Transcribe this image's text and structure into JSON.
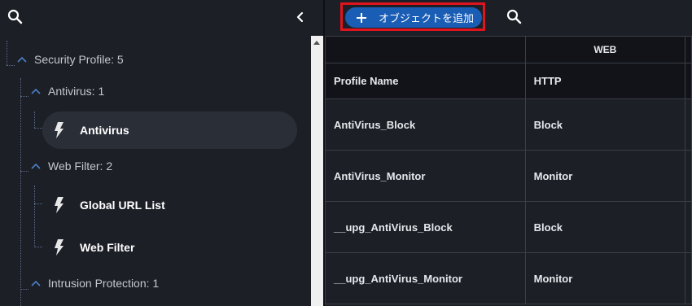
{
  "toolbar": {
    "add_object_label": "オブジェクトを追加"
  },
  "tree": {
    "root": {
      "label": "Security Profile: 5"
    },
    "groups": [
      {
        "label": "Antivirus: 1",
        "items": [
          {
            "label": "Antivirus",
            "selected": true
          }
        ]
      },
      {
        "label": "Web Filter: 2",
        "items": [
          {
            "label": "Global URL List"
          },
          {
            "label": "Web Filter"
          }
        ]
      },
      {
        "label": "Intrusion Protection: 1"
      }
    ]
  },
  "table": {
    "group_header": "WEB",
    "columns": [
      "Profile Name",
      "HTTP"
    ],
    "rows": [
      [
        "AntiVirus_Block",
        "Block"
      ],
      [
        "AntiVirus_Monitor",
        "Monitor"
      ],
      [
        "__upg_AntiVirus_Block",
        "Block"
      ],
      [
        "__upg_AntiVirus_Monitor",
        "Monitor"
      ]
    ]
  },
  "colors": {
    "background": "#1c1f26",
    "accent_button": "#1a5db5",
    "highlight_box": "#e0141e",
    "header_background": "#111318"
  },
  "icons": [
    "search-icon",
    "collapse-panel-icon",
    "chevron-up-icon",
    "bolt-icon",
    "plus-icon"
  ]
}
